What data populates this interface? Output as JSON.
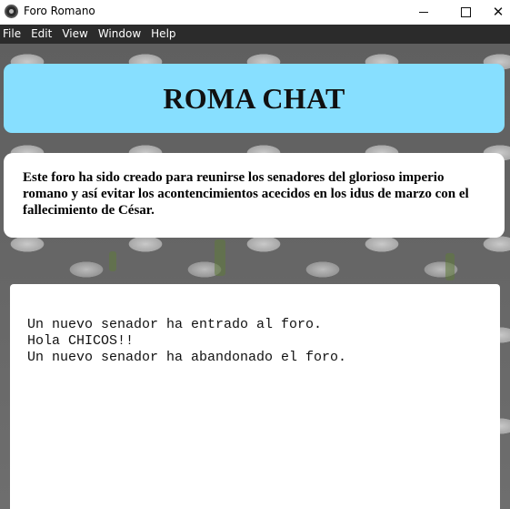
{
  "window": {
    "title": "Foro Romano",
    "controls": {
      "minimize": "minimize-icon",
      "maximize": "maximize-icon",
      "close": "close-icon"
    }
  },
  "menu": [
    "File",
    "Edit",
    "View",
    "Window",
    "Help"
  ],
  "header": {
    "title": "ROMA CHAT",
    "background": "#87dfff"
  },
  "intro": {
    "text": "Este foro ha sido creado para reunirse los senadores del glorioso imperio romano y así evitar los acontencimientos acecidos en los idus de marzo con el fallecimiento de César."
  },
  "chat": {
    "messages": [
      "Un nuevo senador ha entrado al foro.",
      "Hola CHICOS!!",
      "Un nuevo senador ha abandonado el foro."
    ]
  },
  "colors": {
    "menubar": "#2b2b2b",
    "header": "#87dfff",
    "panel": "#ffffff"
  }
}
